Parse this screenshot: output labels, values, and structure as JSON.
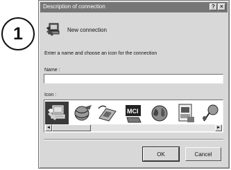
{
  "callout": {
    "number": "1"
  },
  "window": {
    "title": "Description of connection",
    "help_label": "?",
    "close_label": "×"
  },
  "connection": {
    "name": "New connection",
    "icon": "phone-computer-icon"
  },
  "form": {
    "description": "Enter a name and choose an icon for the connection",
    "name_label": "Name :",
    "name_value": "",
    "icon_label": "Icon :",
    "icons": [
      "phone-computer-icon",
      "globe-satellite-icon",
      "phone-network-icon",
      "mci-icon",
      "globe-icon",
      "computer-document-icon",
      "pushpin-icon"
    ],
    "selected_icon_index": 0
  },
  "buttons": {
    "ok": "OK",
    "cancel": "Cancel"
  },
  "scroll": {
    "left_arrow": "◄",
    "right_arrow": "►"
  }
}
